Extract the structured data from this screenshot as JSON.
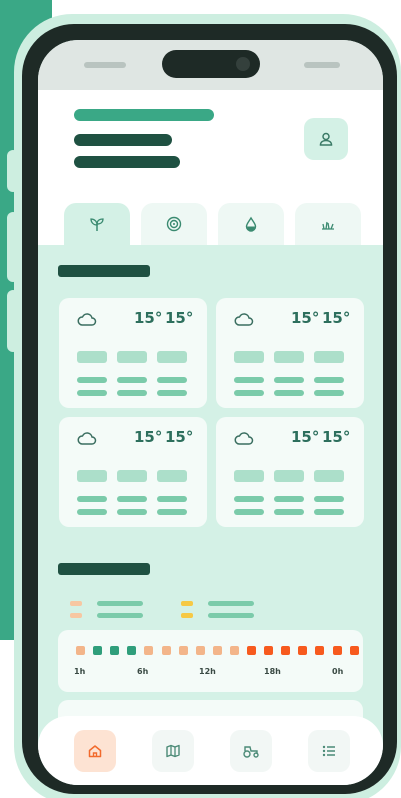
{
  "weather_cards": [
    {
      "temp_high": "15°",
      "temp_low": "15°",
      "icon": "cloud-icon"
    },
    {
      "temp_high": "15°",
      "temp_low": "15°",
      "icon": "cloud-icon"
    },
    {
      "temp_high": "15°",
      "temp_low": "15°",
      "icon": "cloud-icon"
    },
    {
      "temp_high": "15°",
      "temp_low": "15°",
      "icon": "cloud-icon"
    }
  ],
  "tabs": [
    {
      "icon": "sprout-icon",
      "active": true
    },
    {
      "icon": "target-icon",
      "active": false
    },
    {
      "icon": "drop-icon",
      "active": false
    },
    {
      "icon": "grass-icon",
      "active": false
    }
  ],
  "timeline": {
    "labels": [
      "1h",
      "6h",
      "12h",
      "18h",
      "0h"
    ],
    "cells": [
      "#f3b58a",
      "#2f9e7b",
      "#2f9e7b",
      "#2f9e7b",
      "#f3b58a",
      "#f3b58a",
      "#f3b58a",
      "#f3b58a",
      "#f3b58a",
      "#f3b58a",
      "#f75a1e",
      "#f75a1e",
      "#f75a1e",
      "#f75a1e",
      "#f75a1e",
      "#f75a1e",
      "#f75a1e"
    ]
  },
  "nav": [
    {
      "icon": "home-icon",
      "active": true
    },
    {
      "icon": "map-icon",
      "active": false
    },
    {
      "icon": "tractor-icon",
      "active": false
    },
    {
      "icon": "list-icon",
      "active": false
    }
  ],
  "colors": {
    "accent": "#3aa886",
    "dark": "#1f5142",
    "active_nav": "#f26a2c"
  }
}
